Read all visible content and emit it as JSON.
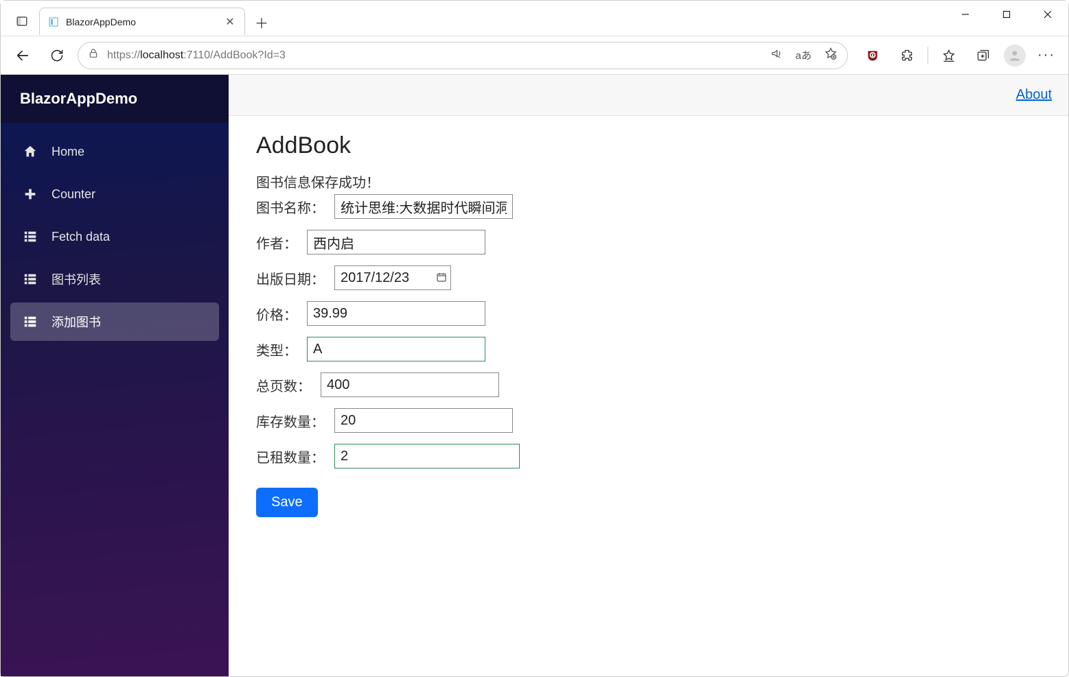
{
  "browser": {
    "tab_title": "BlazorAppDemo",
    "url_protocol": "https://",
    "url_host": "localhost",
    "url_port": ":7110",
    "url_path": "/AddBook?Id=3"
  },
  "sidebar": {
    "brand": "BlazorAppDemo",
    "items": [
      {
        "icon": "home-icon",
        "label": "Home",
        "active": false
      },
      {
        "icon": "plus-icon",
        "label": "Counter",
        "active": false
      },
      {
        "icon": "list-icon",
        "label": "Fetch data",
        "active": false
      },
      {
        "icon": "list-icon",
        "label": "图书列表",
        "active": false
      },
      {
        "icon": "list-icon",
        "label": "添加图书",
        "active": true
      }
    ]
  },
  "topstrip": {
    "about": "About"
  },
  "page": {
    "title": "AddBook",
    "message": "图书信息保存成功！",
    "fields": {
      "name_label": "图书名称：",
      "name_value": "统计思维:大数据时代瞬间洞",
      "author_label": "作者：",
      "author_value": "西内启",
      "pubdate_label": "出版日期：",
      "pubdate_value": "2017/12/23",
      "price_label": "价格：",
      "price_value": "39.99",
      "type_label": "类型：",
      "type_value": "A",
      "pages_label": "总页数：",
      "pages_value": "400",
      "stock_label": "库存数量：",
      "stock_value": "20",
      "rented_label": "已租数量：",
      "rented_value": "2"
    },
    "save_label": "Save"
  }
}
